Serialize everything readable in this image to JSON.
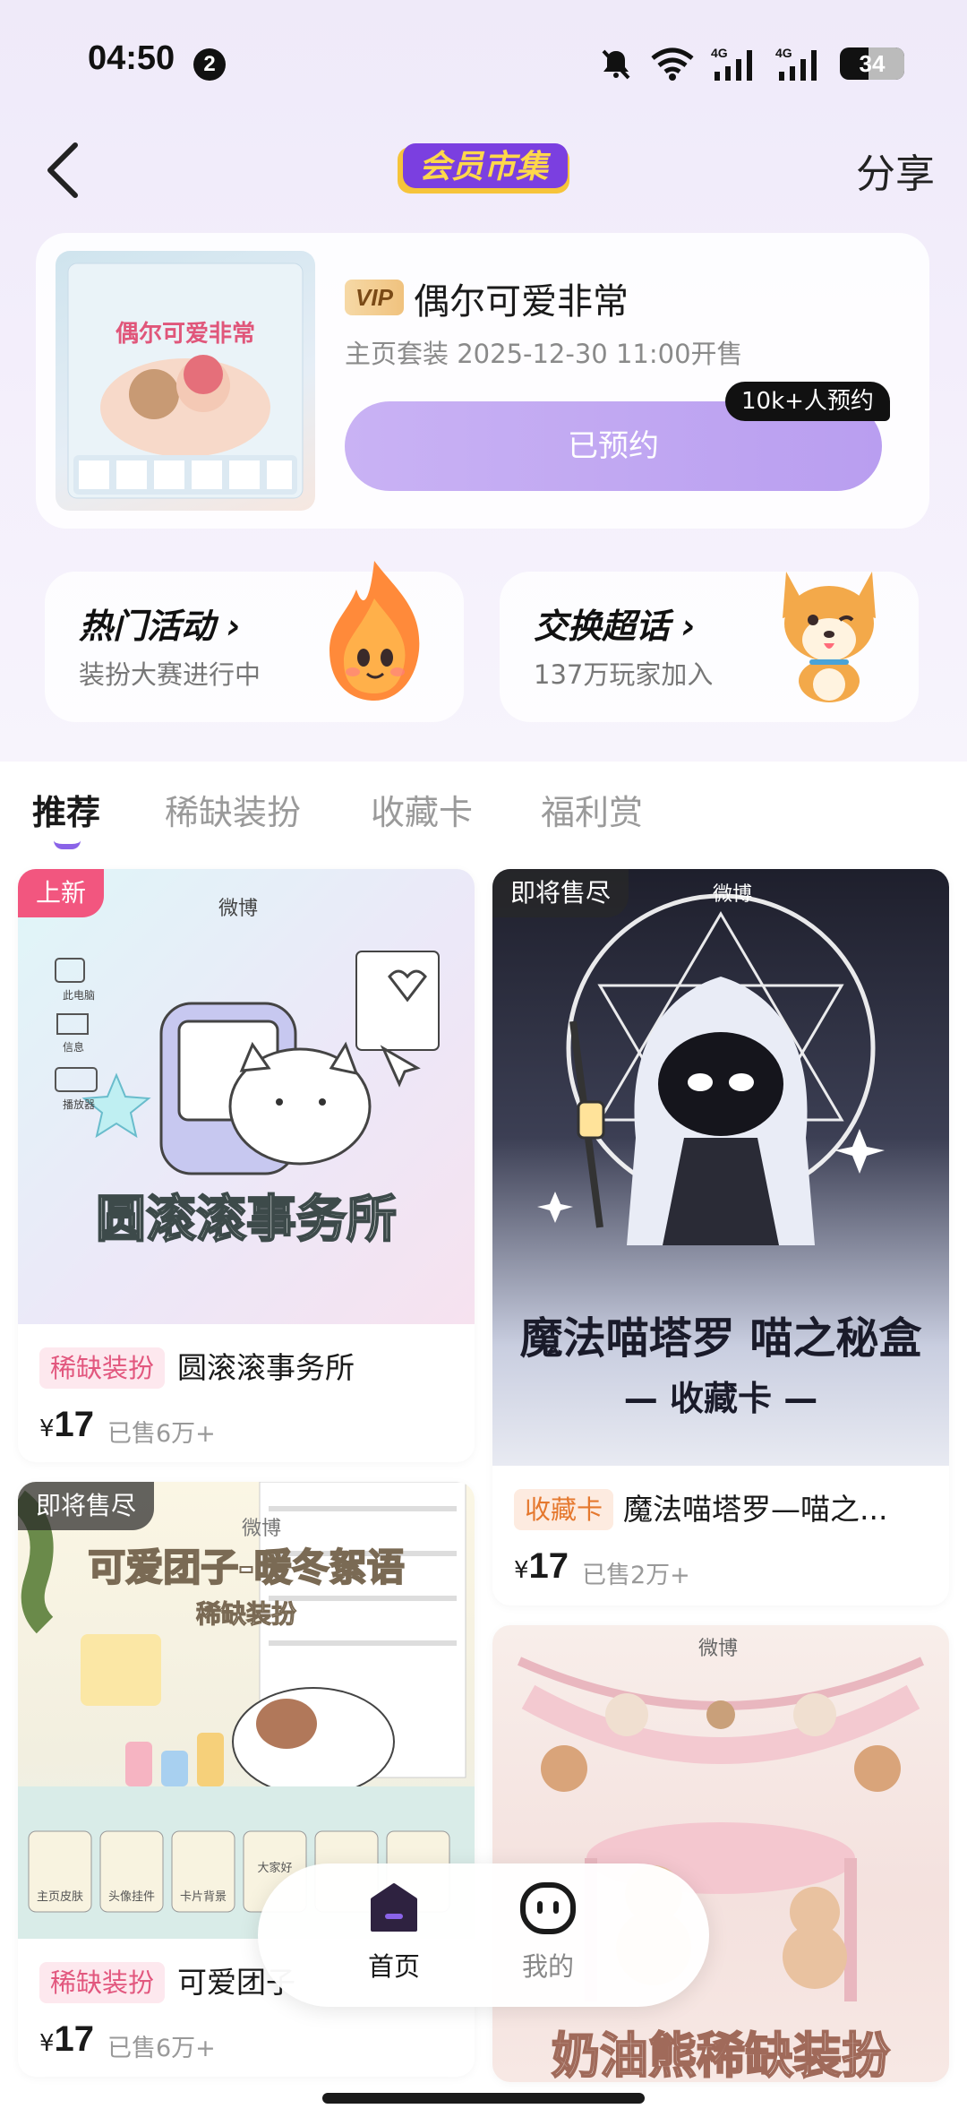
{
  "status_bar": {
    "time": "04:50",
    "notification_count": "2",
    "battery": "34"
  },
  "header": {
    "logo_text": "会员市集",
    "share_label": "分享"
  },
  "featured": {
    "vip_label": "VIP",
    "title": "偶尔可爱非常",
    "subtitle": "主页套装 2025-12-30 11:00开售",
    "reserve_label": "已预约",
    "reserve_count": "10k+人预约",
    "thumb_title": "偶尔可爱非常"
  },
  "entries": [
    {
      "title": "热门活动",
      "subtitle": "装扮大赛进行中",
      "icon": "flame-mascot-icon"
    },
    {
      "title": "交换超话",
      "subtitle": "137万玩家加入",
      "icon": "corgi-mascot-icon"
    }
  ],
  "tabs": [
    {
      "label": "推荐",
      "active": true
    },
    {
      "label": "稀缺装扮",
      "active": false
    },
    {
      "label": "收藏卡",
      "active": false
    },
    {
      "label": "福利赏",
      "active": false
    }
  ],
  "feed": {
    "col1": [
      {
        "corner_tag": "上新",
        "art_title": "圆滚滚事务所",
        "category": "稀缺装扮",
        "name": "圆滚滚事务所",
        "price": "17",
        "currency": "¥",
        "sold": "已售6万+",
        "side_labels": [
          "此电脑",
          "信息",
          "播放器"
        ]
      },
      {
        "corner_tag": "即将售尽",
        "art_title": "可爱团子-暖冬絮语",
        "art_sub": "稀缺装扮",
        "category": "稀缺装扮",
        "name": "可爱团子",
        "price": "17",
        "currency": "¥",
        "sold": "已售6万+",
        "strip_labels": [
          "主页皮肤",
          "头像挂件",
          "卡片背景",
          "大家好"
        ]
      }
    ],
    "col2": [
      {
        "corner_tag": "即将售尽",
        "art_title": "魔法喵塔罗 喵之秘盒",
        "art_sub": "— 收藏卡 —",
        "category": "收藏卡",
        "name": "魔法喵塔罗—喵之...",
        "price": "17",
        "currency": "¥",
        "sold": "已售2万+"
      },
      {
        "art_title": "奶油熊稀缺装扮"
      }
    ],
    "watermark": "微博"
  },
  "bottom_nav": [
    {
      "label": "首页",
      "active": true
    },
    {
      "label": "我的",
      "active": false
    }
  ],
  "colors": {
    "accent": "#8a63e8",
    "reserve_button": "#c2a8f2",
    "new_tag": "#f2567f",
    "rare_tag_text": "#e2577e",
    "collect_tag_text": "#e5782e"
  }
}
